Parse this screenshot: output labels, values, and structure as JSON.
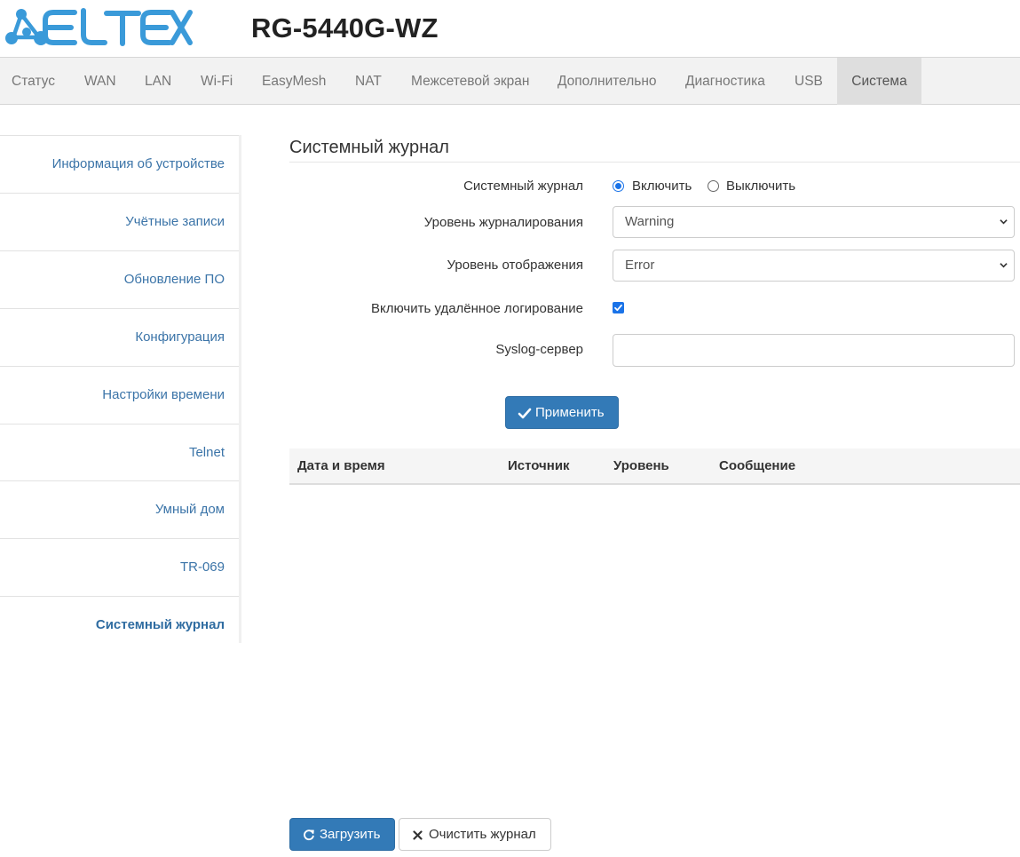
{
  "header": {
    "logo_text": "ELTEX",
    "model": "RG-5440G-WZ",
    "brand_color": "#3a9ad9"
  },
  "nav": {
    "items": [
      {
        "label": "Статус"
      },
      {
        "label": "WAN"
      },
      {
        "label": "LAN"
      },
      {
        "label": "Wi-Fi"
      },
      {
        "label": "EasyMesh"
      },
      {
        "label": "NAT"
      },
      {
        "label": "Межсетевой экран"
      },
      {
        "label": "Дополнительно"
      },
      {
        "label": "Диагностика"
      },
      {
        "label": "USB"
      },
      {
        "label": "Система"
      }
    ],
    "active": "Система"
  },
  "sidebar": {
    "items": [
      {
        "label": "Информация об устройстве"
      },
      {
        "label": "Учётные записи"
      },
      {
        "label": "Обновление ПО"
      },
      {
        "label": "Конфигурация"
      },
      {
        "label": "Настройки времени"
      },
      {
        "label": "Telnet"
      },
      {
        "label": "Умный дом"
      },
      {
        "label": "TR-069"
      },
      {
        "label": "Системный журнал"
      }
    ],
    "active": "Системный журнал"
  },
  "main": {
    "title": "Системный журнал",
    "form": {
      "syslog_label": "Системный журнал",
      "enable_label": "Включить",
      "disable_label": "Выключить",
      "syslog_state": "enabled",
      "log_level_label": "Уровень журналирования",
      "log_level_value": "Warning",
      "display_level_label": "Уровень отображения",
      "display_level_value": "Error",
      "remote_label": "Включить удалённое логирование",
      "remote_checked": true,
      "server_label": "Syslog-сервер",
      "server_value": "",
      "apply_label": "Применить"
    },
    "table": {
      "columns": [
        "Дата и время",
        "Источник",
        "Уровень",
        "Сообщение"
      ],
      "rows": []
    },
    "footer": {
      "load_label": "Загрузить",
      "clear_label": "Очистить журнал"
    }
  },
  "colors": {
    "primary_button": "#337ab7",
    "link": "#3b74a8",
    "accent": "#1a73e8"
  }
}
